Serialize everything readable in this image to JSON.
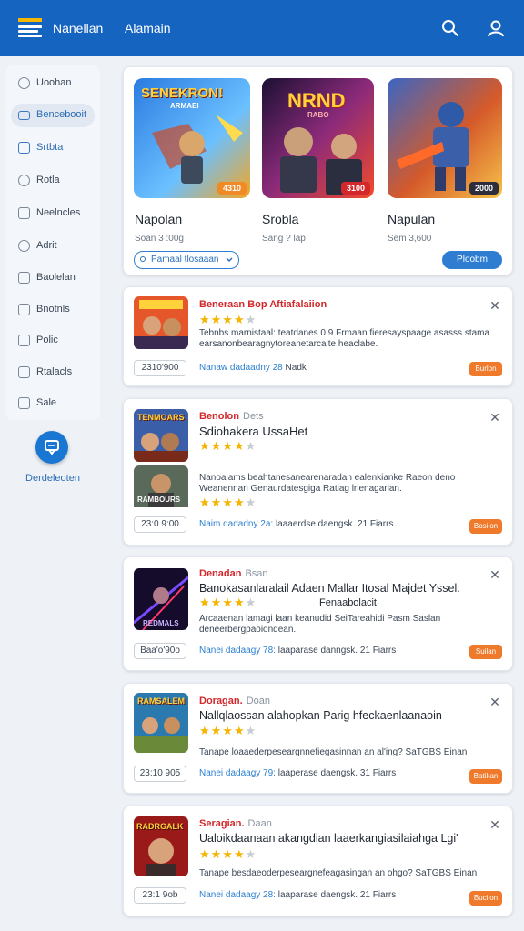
{
  "header": {
    "link1": "Nanellan",
    "link2": "Alamain",
    "search_icon": "search-icon",
    "account_icon": "user-icon"
  },
  "sidebar": {
    "items": [
      {
        "label": "Uoohan",
        "icon": "clock-icon"
      },
      {
        "label": "Bencebooit",
        "icon": "card-icon"
      },
      {
        "label": "Srtbta",
        "icon": "square-icon"
      },
      {
        "label": "Rotla",
        "icon": "smile-icon"
      },
      {
        "label": "Neelncles",
        "icon": "doc-icon"
      },
      {
        "label": "Adrit",
        "icon": "circle-icon"
      },
      {
        "label": "Baolelan",
        "icon": "book-icon"
      },
      {
        "label": "Bnotnls",
        "icon": "tag-icon"
      },
      {
        "label": "Polic",
        "icon": "home-icon"
      },
      {
        "label": "Rtalacls",
        "icon": "bag-icon"
      },
      {
        "label": "Sale",
        "icon": "sale-icon"
      }
    ],
    "fab_label": "Derdeleoten"
  },
  "featured": {
    "games": [
      {
        "art_text": "SENEKRON!",
        "art_sub": "ARMAEI",
        "badge": "4310",
        "name": "Napolan",
        "sub": "Soan 3 :00g"
      },
      {
        "art_text": "NRND",
        "art_sub": "RABO",
        "badge": "3100",
        "name": "Srobla",
        "sub": "Sang ? lap"
      },
      {
        "art_text": "",
        "art_sub": "",
        "badge": "2000",
        "name": "Napulan",
        "sub": "Sem 3,600"
      }
    ],
    "sort_label": "Pamaal tlosaaan",
    "cta_label": "Ploobm"
  },
  "list": [
    {
      "title": "Beneraan Bop Aftiafalaiion",
      "meta": "",
      "headline": "",
      "stars": 4,
      "desc": [
        "Tebnbs marnistaal: teatdanes 0.9 Frmaan fieresayspaage asasss stama",
        "earsanonbearagnytoreanetarcalte heaclabe."
      ],
      "price": "2310'900",
      "dl_prefix": "Nanaw dadaadny 28",
      "dl_rest": "Nadk",
      "button": "Burlon"
    },
    {
      "title": "Benolon",
      "meta": "Dets",
      "headline": "Sdiohakera UssaHet",
      "stars": 4,
      "desc": [
        "Nanoalams beahtanesanearenaradan ealenkianke Raeon deno",
        "Weanennan Genaurdatesgiga Ratiag lrienagarlan."
      ],
      "stars2": 4,
      "price": "23:0 9:00",
      "dl_prefix": "Naim dadadny 2a:",
      "dl_rest": "laaaerdse daengsk. 21 Fiarrs",
      "button": "Bosilon",
      "art_text": "TENMOARS",
      "art2_text": "RAMBOURS"
    },
    {
      "title": "Denadan",
      "meta": "Bsan",
      "headline": "Banokasanlaralail Adaen  Mallar Itosal Majdet Yssel.",
      "headline2": "Fenaabolacit",
      "stars": 4,
      "desc": [
        "Arcaaenan lamagi laan keanudid SeiTareahidi Pasm Saslan",
        "deneerbergpaoiondean."
      ],
      "price": "Baa'o'90o",
      "dl_prefix": "Nanei dadaagy 78:",
      "dl_rest": "laaparase danngsk. 21 Fiarrs",
      "button": "Suilan",
      "art_text": "REDMALS"
    },
    {
      "title": "Doragan.",
      "meta": "Doan",
      "headline": "Nallqlaossan alahopkan Parig hfeckaenlaanaoin",
      "stars": 4,
      "desc": [
        "Tanape loaaederpeseargnnefiegasinnan an al'ing? SaTGBS Einan"
      ],
      "price": "23:10 905",
      "dl_prefix": "Nanei dadaagy 79:",
      "dl_rest": "laaperase daengsk. 31 Fiarrs",
      "button": "Batikan",
      "art_text": "RAMSALEM"
    },
    {
      "title": "Seragian.",
      "meta": "Daan",
      "headline": "Ualoikdaanaan akangdian laaerkangiasilaiahga Lgi'",
      "stars": 4,
      "desc": [
        "Tanape besdaeoderpeseargnefeagasingan an ohgo? SaTGBS Einan"
      ],
      "price": "23:1 9ob",
      "dl_prefix": "Nanei dadaagy 28:",
      "dl_rest": "laaparase daengsk. 21 Fiarrs",
      "button": "Bucilon",
      "art_text": "RADRGALK"
    }
  ]
}
